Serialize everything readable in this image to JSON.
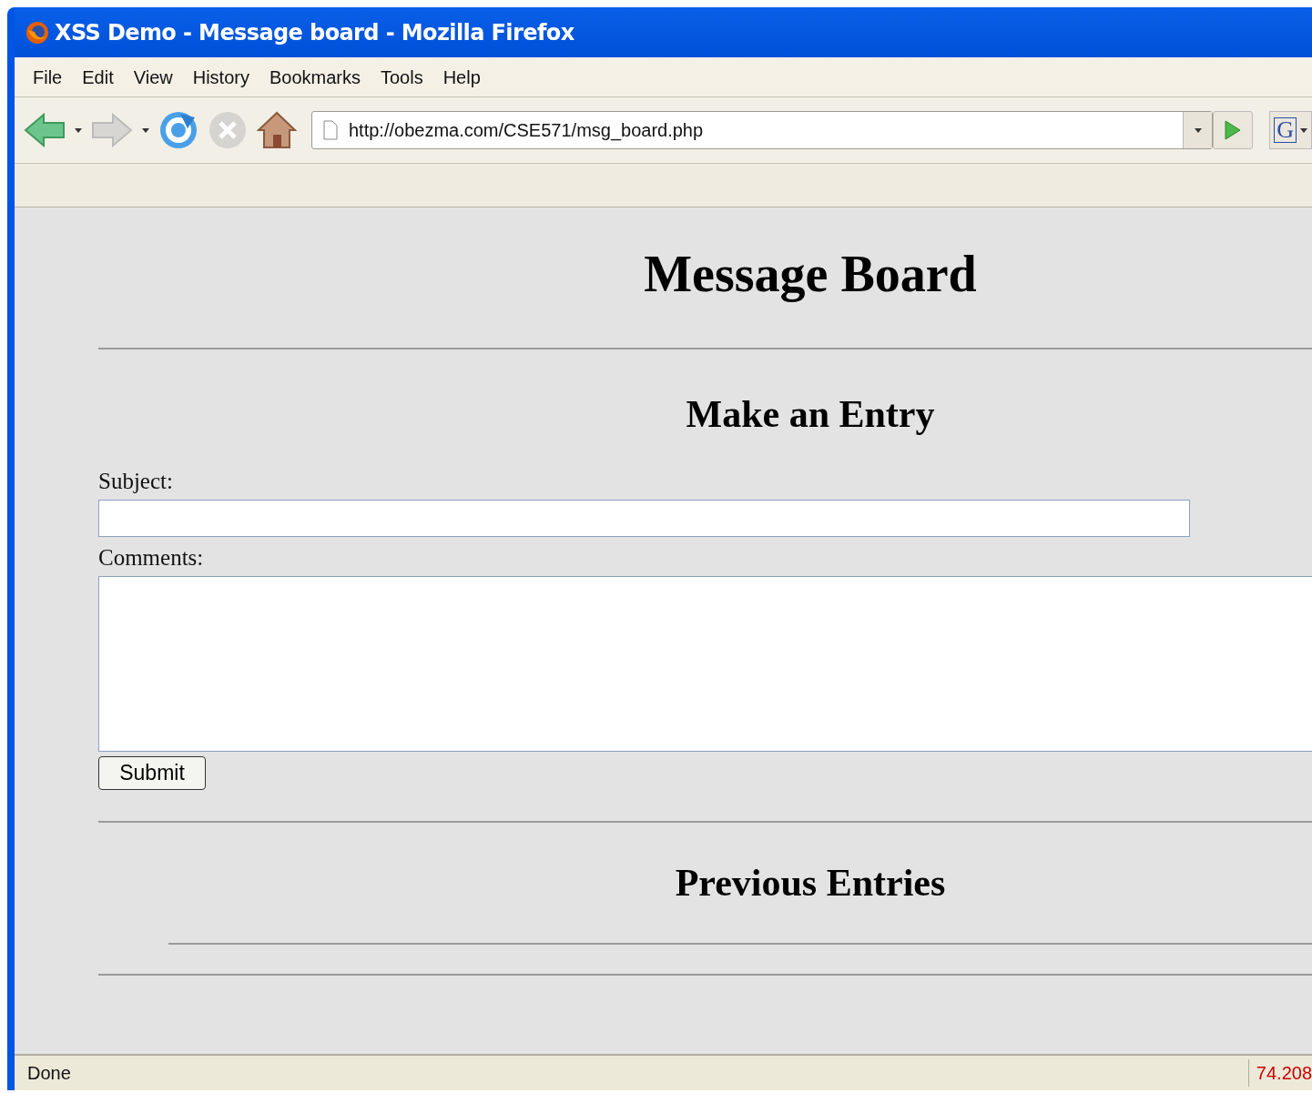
{
  "window": {
    "title": "XSS Demo - Message board - Mozilla Firefox"
  },
  "menu": [
    "File",
    "Edit",
    "View",
    "History",
    "Bookmarks",
    "Tools",
    "Help"
  ],
  "toolbar": {
    "back_disabled": false,
    "forward_disabled": true,
    "stop_disabled": true,
    "url": "http://obezma.com/CSE571/msg_board.php",
    "search_engine": "G"
  },
  "page": {
    "title": "Message Board",
    "form_heading": "Make an Entry",
    "subject_label": "Subject:",
    "comments_label": "Comments:",
    "submit": "Submit",
    "entries_heading": "Previous Entries"
  },
  "status_bar": {
    "status": "Done",
    "address": "74.208"
  }
}
